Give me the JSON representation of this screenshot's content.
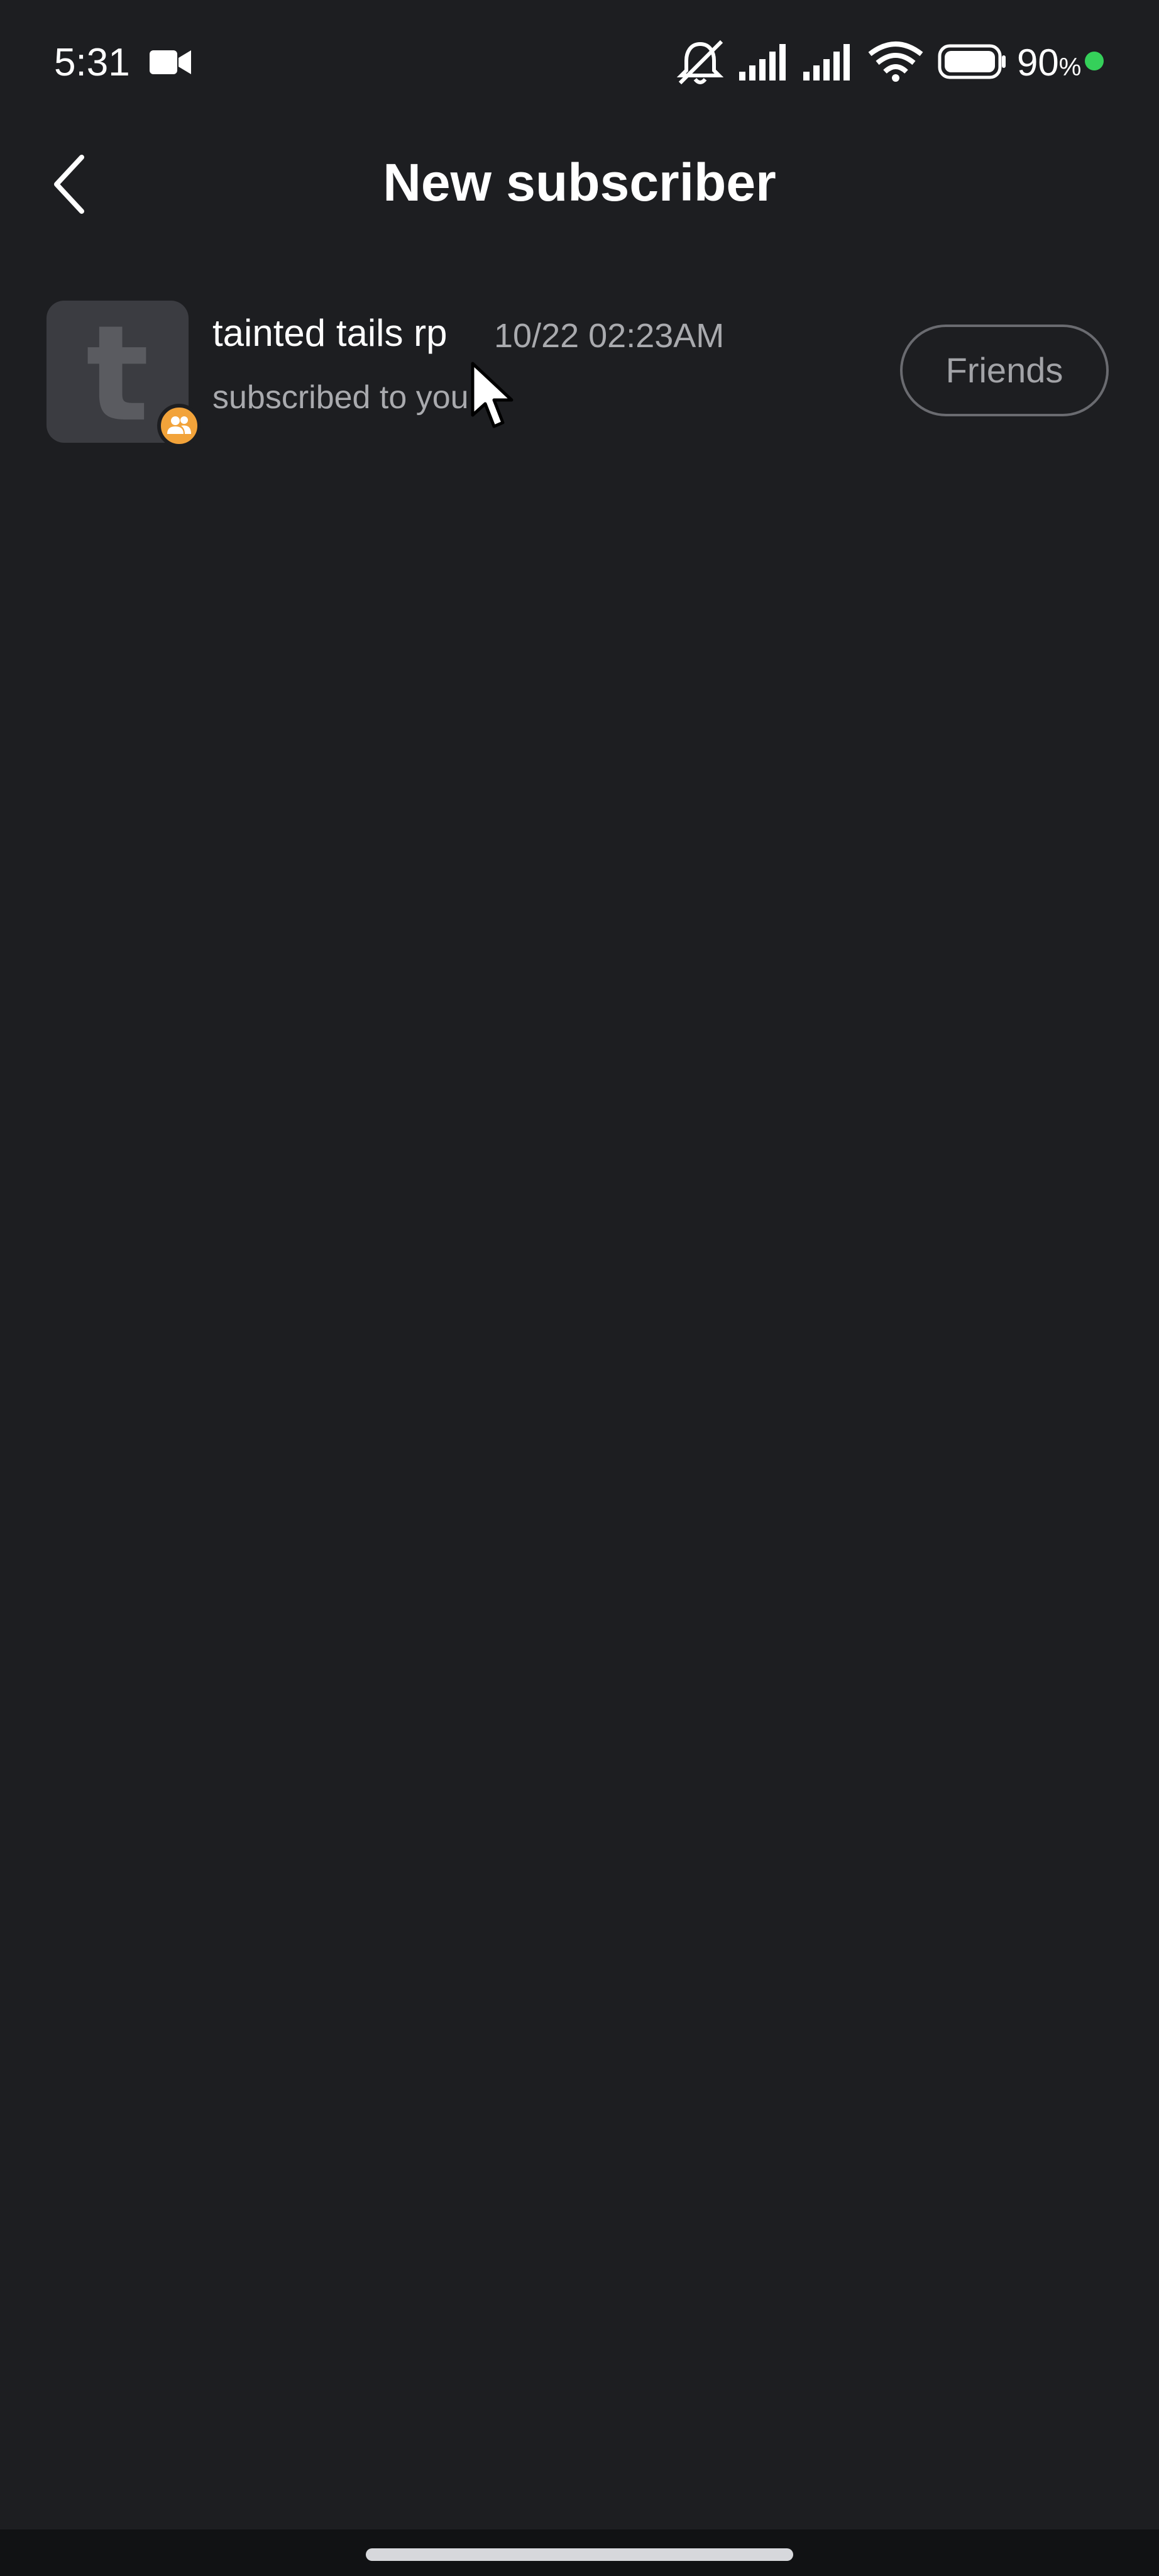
{
  "status_bar": {
    "time": "5:31",
    "battery_level": "90",
    "battery_unit": "%",
    "icons": [
      "video-camera-icon",
      "bell-off-icon",
      "signal-icon",
      "signal-icon",
      "wifi-icon",
      "battery-icon"
    ],
    "charge_color": "#35d05a"
  },
  "header": {
    "back_icon": "chevron-left-icon",
    "title": "New subscriber"
  },
  "notifications": [
    {
      "name": "tainted tails rp",
      "time": "10/22 02:23AM",
      "message": "subscribed to you",
      "avatar_letter": "t",
      "badge_icon": "group-icon",
      "badge_color": "#f2a33a",
      "action_label": "Friends"
    }
  ],
  "colors": {
    "background": "#1d1e21",
    "text_primary": "#ffffff",
    "text_secondary": "#a9aaae",
    "button_border": "#6a6b70"
  }
}
